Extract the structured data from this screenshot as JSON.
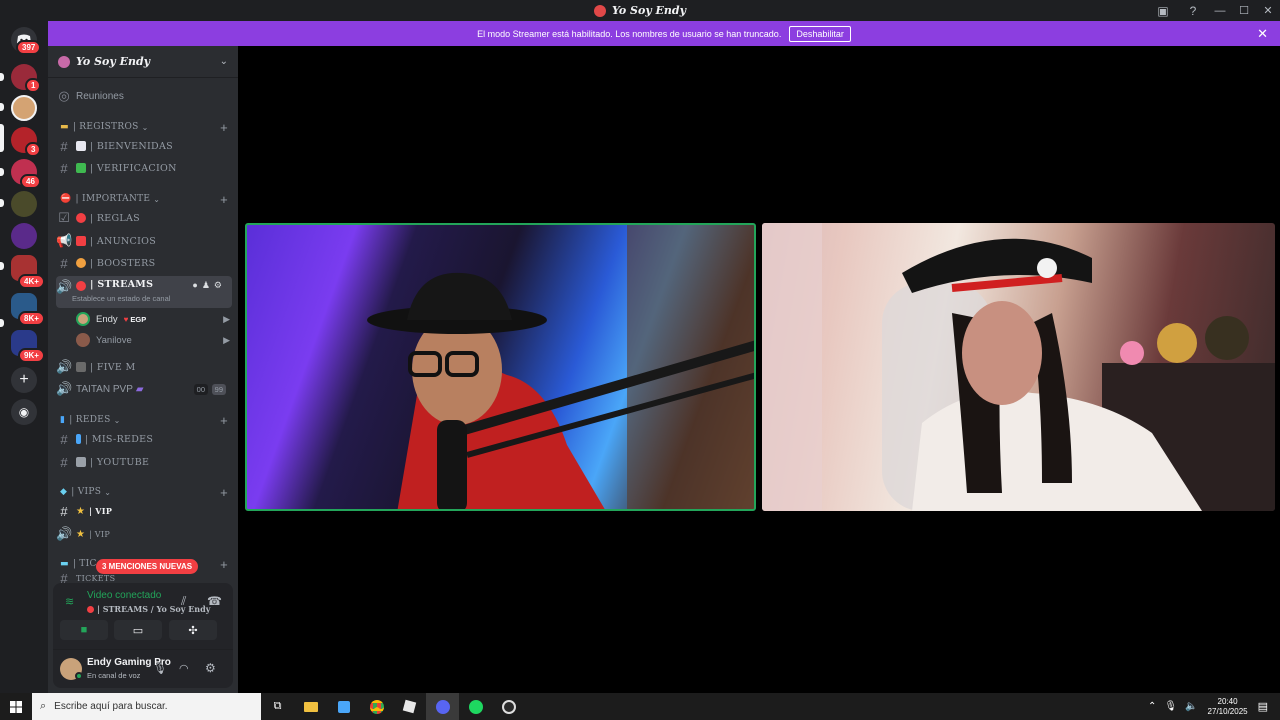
{
  "window": {
    "title": "Yo Soy Endy"
  },
  "servers": {
    "home_badge": "397",
    "items": [
      {
        "badge": "1",
        "color": "#9a2a3a"
      },
      {
        "badge": "",
        "color": "#d4a373"
      },
      {
        "badge": "3",
        "color": "#b4232a"
      },
      {
        "badge": "46",
        "color": "#c03050"
      },
      {
        "badge": "",
        "color": "#4a4a2a"
      },
      {
        "badge": "",
        "color": "#5a2a8a"
      },
      {
        "badge": "4K+",
        "color": "#a83232"
      },
      {
        "badge": "8K+",
        "color": "#2a5a8a"
      },
      {
        "badge": "9K+",
        "color": "#2a3a8a"
      }
    ]
  },
  "banner": {
    "text": "El modo Streamer está habilitado. Los nombres de usuario se han truncado.",
    "button": "Deshabilitar"
  },
  "sidebar": {
    "server_name": "Yo Soy Endy",
    "reuniones": "Reuniones",
    "categories": {
      "registros": "| REGISTROS",
      "importante": "| IMPORTANTE",
      "redes": "| REDES",
      "vips": "| VIPS",
      "tickets": "| TIC"
    },
    "channels": {
      "bienvenidas": "| BIENVENIDAS",
      "verificacion": "| VERIFICACION",
      "reglas": "| REGLAS",
      "anuncios": "| ANUNCIOS",
      "boosters": "| BOOSTERS",
      "streams": "| STREAMS",
      "streams_status": "Establece un estado de canal",
      "five_m": "| FIVE M",
      "taitan": "TAITAN PVP",
      "taitan_count_a": "00",
      "taitan_count_b": "99",
      "mis_redes": "| MIS-REDES",
      "youtube": "| YOUTUBE",
      "vip_text": "| VIP",
      "vip_voice": "| VIP",
      "tickets_partial": "TICKETS"
    },
    "voice_users": [
      {
        "name": "Endy",
        "tag": "EGP"
      },
      {
        "name": "Yanilove",
        "tag": ""
      }
    ],
    "mentions_pill": "3 MENCIONES NUEVAS"
  },
  "voice_panel": {
    "status": "Video conectado",
    "channel": "| STREAMS / Yo Soy Endy",
    "user_name": "Endy Gaming Pro",
    "user_status": "En canal de voz"
  },
  "taskbar": {
    "search_placeholder": "Escribe aquí para buscar.",
    "time": "20:40",
    "date": "27/10/2025"
  }
}
